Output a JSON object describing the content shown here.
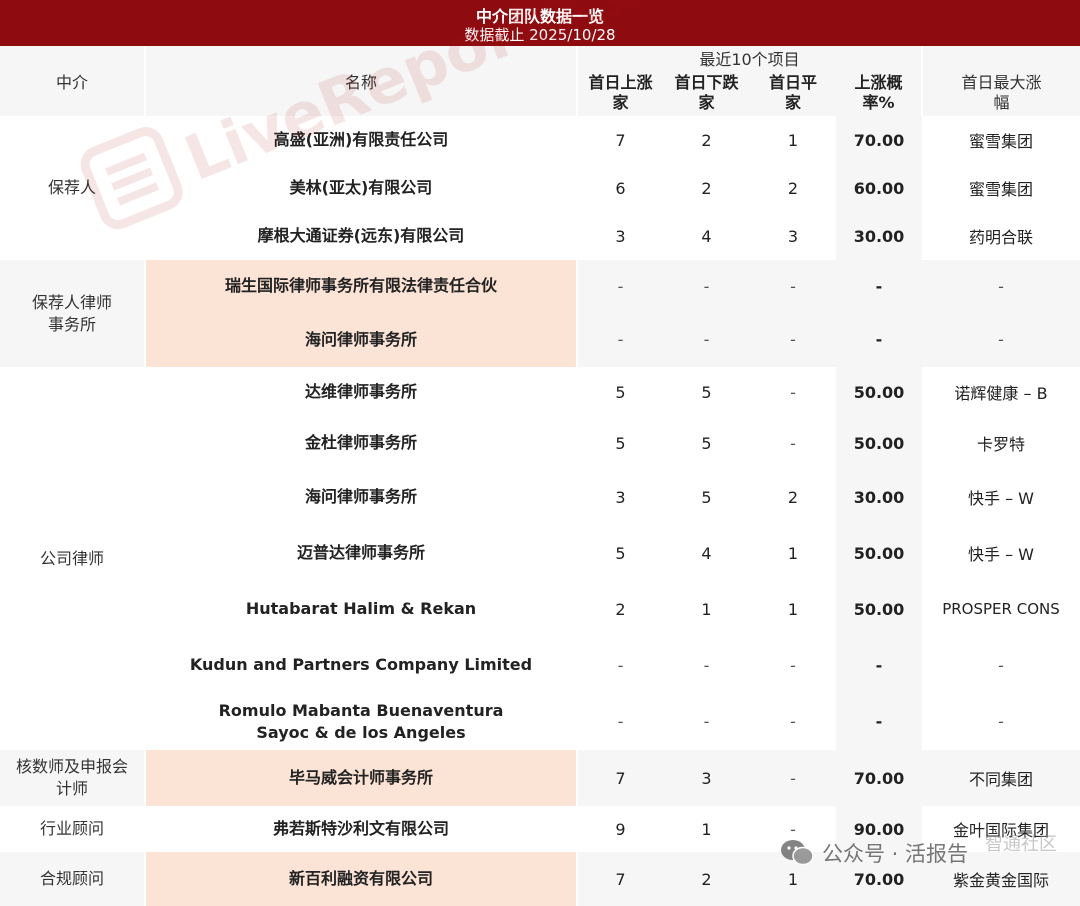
{
  "title": "中介团队数据一览",
  "subtitle": "数据截止 2025/10/28",
  "header": {
    "col_intermediary": "中介",
    "col_name": "名称",
    "group_label": "最近10个项目",
    "col_up": "首日上涨家",
    "col_down": "首日下跌家",
    "col_flat": "首日平家",
    "col_rate": "上涨概率%",
    "col_max": "首日最大涨幅"
  },
  "sections": [
    {
      "category": "保荐人",
      "rows": [
        {
          "name": "高盛(亚洲)有限责任公司",
          "up": "7",
          "down": "2",
          "flat": "1",
          "rate": "70.00",
          "max": "蜜雪集团"
        },
        {
          "name": "美林(亚太)有限公司",
          "up": "6",
          "down": "2",
          "flat": "2",
          "rate": "60.00",
          "max": "蜜雪集团"
        },
        {
          "name": "摩根大通证券(远东)有限公司",
          "up": "3",
          "down": "4",
          "flat": "3",
          "rate": "30.00",
          "max": "药明合联"
        }
      ]
    },
    {
      "category": "保荐人律师事务所",
      "rows": [
        {
          "name": "瑞生国际律师事务所有限法律责任合伙",
          "up": "-",
          "down": "-",
          "flat": "-",
          "rate": "-",
          "max": "-"
        },
        {
          "name": "海问律师事务所",
          "up": "-",
          "down": "-",
          "flat": "-",
          "rate": "-",
          "max": "-"
        }
      ]
    },
    {
      "category": "公司律师",
      "rows": [
        {
          "name": "达维律师事务所",
          "up": "5",
          "down": "5",
          "flat": "-",
          "rate": "50.00",
          "max": "诺辉健康 – B"
        },
        {
          "name": "金杜律师事务所",
          "up": "5",
          "down": "5",
          "flat": "-",
          "rate": "50.00",
          "max": "卡罗特"
        },
        {
          "name": "海问律师事务所",
          "up": "3",
          "down": "5",
          "flat": "2",
          "rate": "30.00",
          "max": "快手 – W"
        },
        {
          "name": "迈普达律师事务所",
          "up": "5",
          "down": "4",
          "flat": "1",
          "rate": "50.00",
          "max": "快手 – W"
        },
        {
          "name": "Hutabarat Halim & Rekan",
          "up": "2",
          "down": "1",
          "flat": "1",
          "rate": "50.00",
          "max": "PROSPER CONS"
        },
        {
          "name": "Kudun and Partners Company Limited",
          "up": "-",
          "down": "-",
          "flat": "-",
          "rate": "-",
          "max": "-"
        },
        {
          "name": "Romulo Mabanta Buenaventura Sayoc & de los Angeles",
          "up": "-",
          "down": "-",
          "flat": "-",
          "rate": "-",
          "max": "-"
        }
      ]
    },
    {
      "category": "核数师及申报会计师",
      "rows": [
        {
          "name": "毕马威会计师事务所",
          "up": "7",
          "down": "3",
          "flat": "-",
          "rate": "70.00",
          "max": "不同集团"
        }
      ]
    },
    {
      "category": "行业顾问",
      "rows": [
        {
          "name": "弗若斯特沙利文有限公司",
          "up": "9",
          "down": "1",
          "flat": "-",
          "rate": "90.00",
          "max": "金叶国际集团"
        }
      ]
    },
    {
      "category": "合规顾问",
      "rows": [
        {
          "name": "新百利融资有限公司",
          "up": "7",
          "down": "2",
          "flat": "1",
          "rate": "70.00",
          "max": "紫金黄金国际"
        }
      ]
    }
  ],
  "watermark": {
    "text": "LiveReport大数據"
  },
  "footer_watermark": {
    "text": "公众号 · 活报告",
    "community": "智通社区"
  }
}
